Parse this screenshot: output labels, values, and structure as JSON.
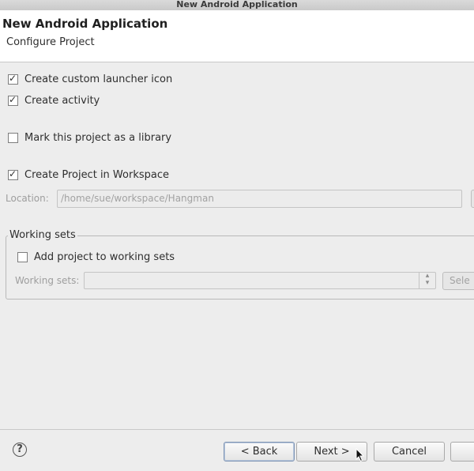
{
  "window": {
    "title": "New Android Application"
  },
  "banner": {
    "title": "New Android Application",
    "subtitle": "Configure Project"
  },
  "options": [
    {
      "label": "Create custom launcher icon",
      "checked": true
    },
    {
      "label": "Create activity",
      "checked": true
    },
    {
      "label": "Mark this project as a library",
      "checked": false
    },
    {
      "label": "Create Project in Workspace",
      "checked": true
    }
  ],
  "location": {
    "label": "Location:",
    "value": "/home/sue/workspace/Hangman"
  },
  "working_sets": {
    "group_label": "Working sets",
    "add_label": "Add project to working sets",
    "add_checked": false,
    "field_label": "Working sets:",
    "select_button": "Sele"
  },
  "footer": {
    "back": "< Back",
    "next": "Next >",
    "cancel": "Cancel",
    "help_glyph": "?"
  },
  "check_glyph": "✓"
}
